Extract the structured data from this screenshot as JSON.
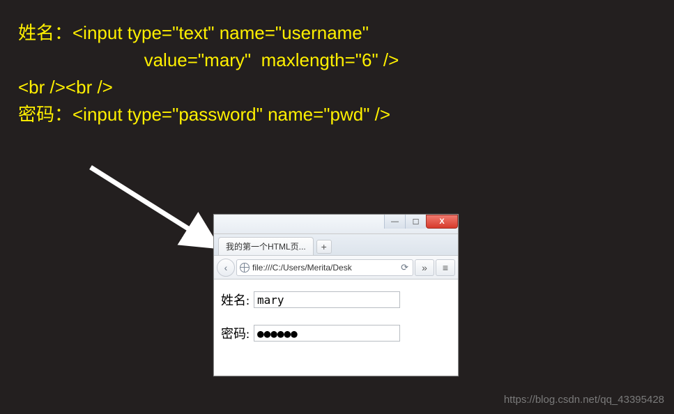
{
  "code": {
    "line1": "姓名：<input type=\"text\" name=\"username\"",
    "line2": "                         value=\"mary\"  maxlength=\"6\" />",
    "line3": "<br /><br />",
    "line4": "密码：<input type=\"password\" name=\"pwd\" />"
  },
  "browser": {
    "tab_title": "我的第一个HTML页...",
    "new_tab_label": "+",
    "back_glyph": "‹",
    "url": "file:///C:/Users/Merita/Desk",
    "reload_glyph": "⟳",
    "more_glyph": "»",
    "menu_glyph": "≡",
    "win_min": "—",
    "win_max": "☐",
    "win_close": "X"
  },
  "form": {
    "name_label": "姓名:",
    "name_value": "mary",
    "pwd_label": "密码:",
    "pwd_value": "●●●●●●"
  },
  "watermark": "https://blog.csdn.net/qq_43395428"
}
